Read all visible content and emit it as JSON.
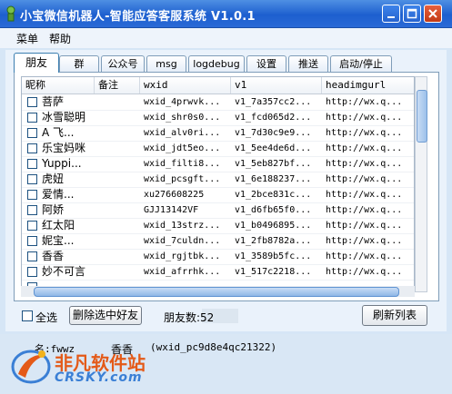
{
  "window": {
    "title": "小宝微信机器人-智能应答客服系统 V1.0.1"
  },
  "menu": [
    "菜单",
    "帮助"
  ],
  "tabs": [
    "朋友",
    "群",
    "公众号",
    "msg",
    "logdebug",
    "设置",
    "推送",
    "启动/停止"
  ],
  "table": {
    "columns": [
      "昵称",
      "备注",
      "wxid",
      "v1",
      "headimgurl"
    ],
    "rows": [
      {
        "nick": "菩萨",
        "remark": "",
        "wxid": "wxid_4prwvk...",
        "v1": "v1_7a357cc2...",
        "head": "http://wx.q..."
      },
      {
        "nick": "冰雪聪明",
        "remark": "",
        "wxid": "wxid_shr0s0...",
        "v1": "v1_fcd065d2...",
        "head": "http://wx.q..."
      },
      {
        "nick": "A 飞...",
        "remark": "",
        "wxid": "wxid_alv0ri...",
        "v1": "v1_7d30c9e9...",
        "head": "http://wx.q..."
      },
      {
        "nick": "乐宝妈咪",
        "remark": "",
        "wxid": "wxid_jdt5eo...",
        "v1": "v1_5ee4de6d...",
        "head": "http://wx.q..."
      },
      {
        "nick": "Yuppi...",
        "remark": "",
        "wxid": "wxid_filti8...",
        "v1": "v1_5eb827bf...",
        "head": "http://wx.q..."
      },
      {
        "nick": "虎妞",
        "remark": "",
        "wxid": "wxid_pcsgft...",
        "v1": "v1_6e188237...",
        "head": "http://wx.q..."
      },
      {
        "nick": "爱情...",
        "remark": "",
        "wxid": "xu276608225",
        "v1": "v1_2bce831c...",
        "head": "http://wx.q..."
      },
      {
        "nick": "阿娇",
        "remark": "",
        "wxid": "GJJ13142VF",
        "v1": "v1_d6fb65f0...",
        "head": "http://wx.q..."
      },
      {
        "nick": "红太阳",
        "remark": "",
        "wxid": "wxid_13strz...",
        "v1": "v1_b0496895...",
        "head": "http://wx.q..."
      },
      {
        "nick": "妮宝...",
        "remark": "",
        "wxid": "wxid_7culdn...",
        "v1": "v1_2fb8782a...",
        "head": "http://wx.q..."
      },
      {
        "nick": "香香",
        "remark": "",
        "wxid": "wxid_rgjtbk...",
        "v1": "v1_3589b5fc...",
        "head": "http://wx.q..."
      },
      {
        "nick": "妙不可言",
        "remark": "",
        "wxid": "wxid_afrrhk...",
        "v1": "v1_517c2218...",
        "head": "http://wx.q..."
      }
    ]
  },
  "bottom": {
    "select_all_label": "全选",
    "delete_button": "删除选中好友",
    "friend_count_label": "朋友数:52",
    "refresh_button": "刷新列表"
  },
  "status": {
    "name_label": "名:fwwz",
    "nick": "香香",
    "wxid": "(wxid_pc9d8e4qc21322)"
  },
  "watermark": {
    "text": "非凡软件站",
    "url": "CRSKY.com"
  },
  "colors": {
    "titlebar": "#1d5fcf",
    "close_button": "#c23a15",
    "watermark_orange": "#e45a18",
    "watermark_blue": "#3a7fd5"
  }
}
